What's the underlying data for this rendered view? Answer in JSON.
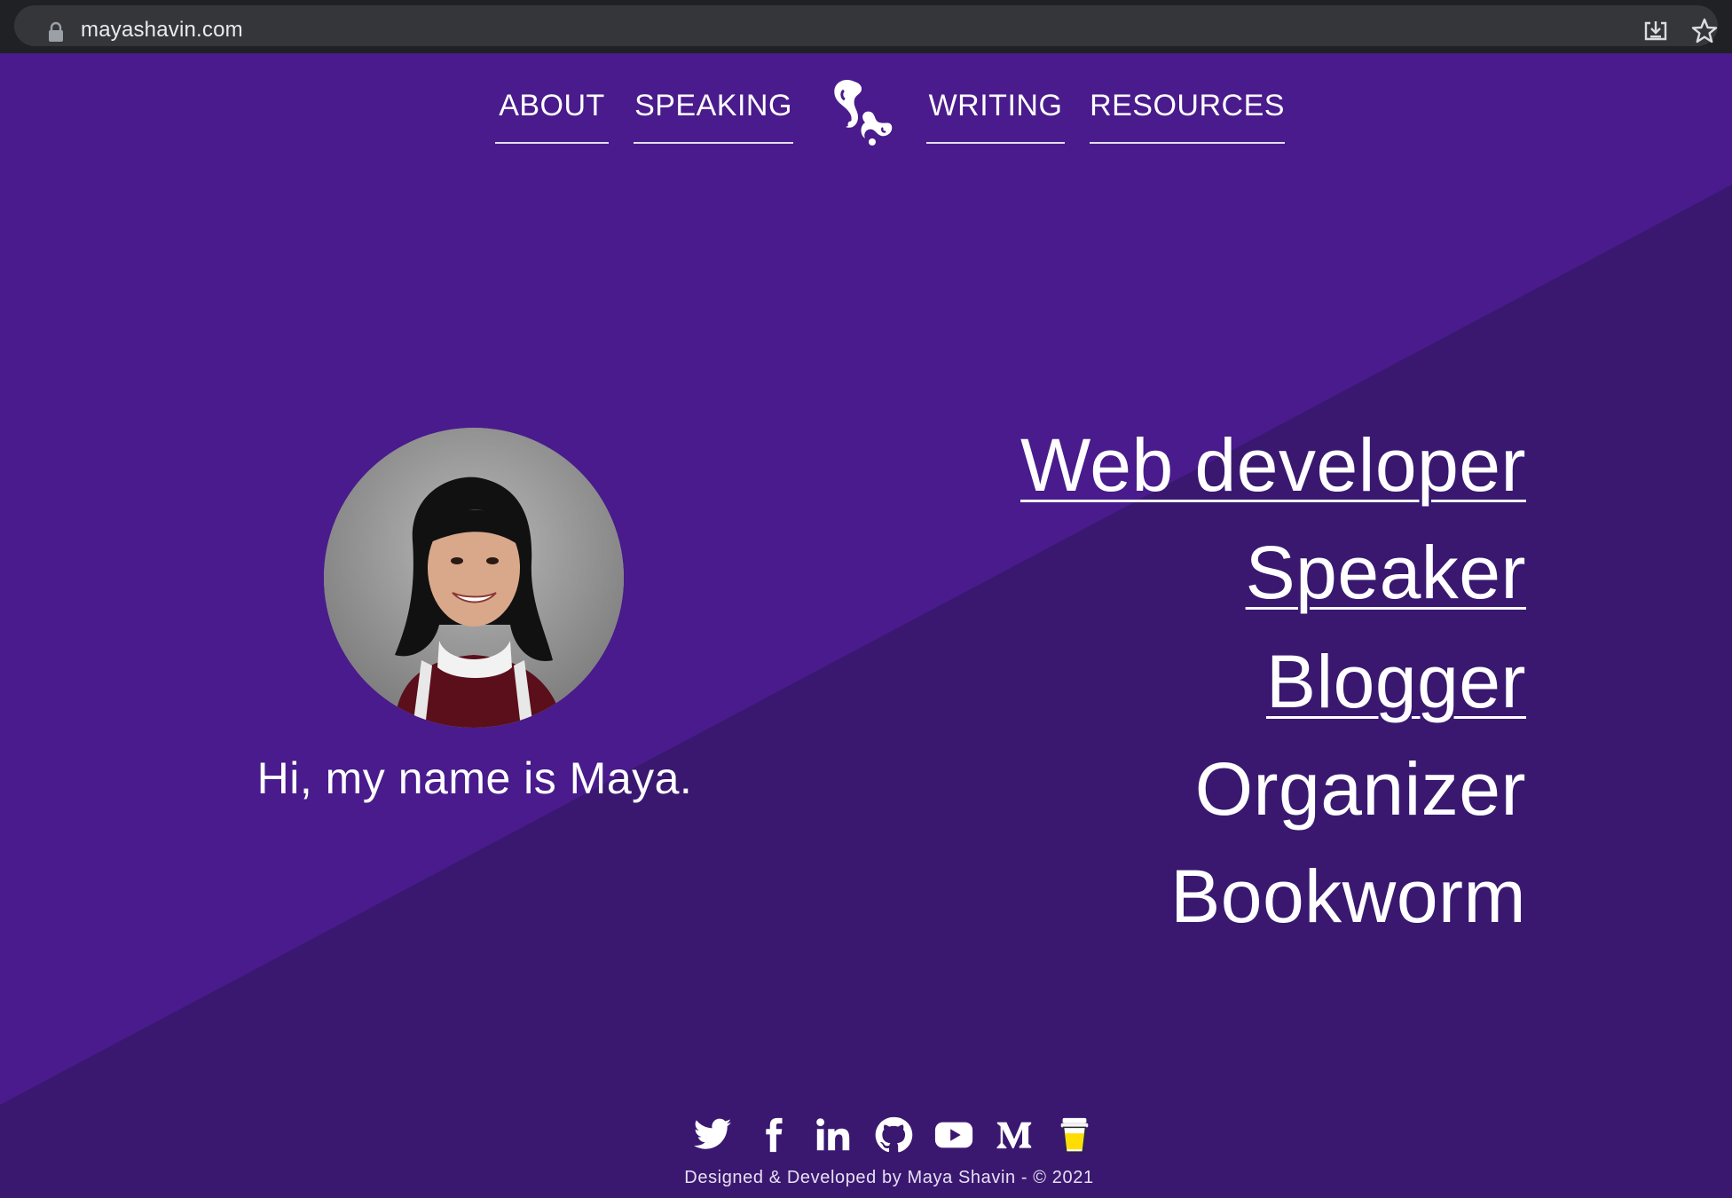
{
  "browser": {
    "url": "mayashavin.com",
    "icons": [
      "lock-icon",
      "install-icon",
      "star-icon"
    ]
  },
  "nav": {
    "items": [
      {
        "label": "ABOUT"
      },
      {
        "label": "SPEAKING"
      },
      {
        "label": "WRITING"
      },
      {
        "label": "RESOURCES"
      }
    ],
    "logo_icon": "butterfly-logo-icon"
  },
  "hero": {
    "greeting": "Hi, my name is Maya.",
    "avatar_icon": "profile-photo"
  },
  "roles": [
    {
      "label": "Web developer",
      "linked": true
    },
    {
      "label": "Speaker",
      "linked": true
    },
    {
      "label": "Blogger",
      "linked": true
    },
    {
      "label": "Organizer",
      "linked": false
    },
    {
      "label": "Bookworm",
      "linked": false
    }
  ],
  "social": {
    "icons": [
      "twitter-icon",
      "facebook-icon",
      "linkedin-icon",
      "github-icon",
      "youtube-icon",
      "medium-icon",
      "buy-me-a-coffee-icon"
    ]
  },
  "footer": {
    "text": "Designed & Developed by Maya Shavin - © 2021"
  },
  "colors": {
    "background_light": "#491b8c",
    "background_dark": "#3a1870",
    "browser_bar": "#202124",
    "text": "#ffffff"
  }
}
